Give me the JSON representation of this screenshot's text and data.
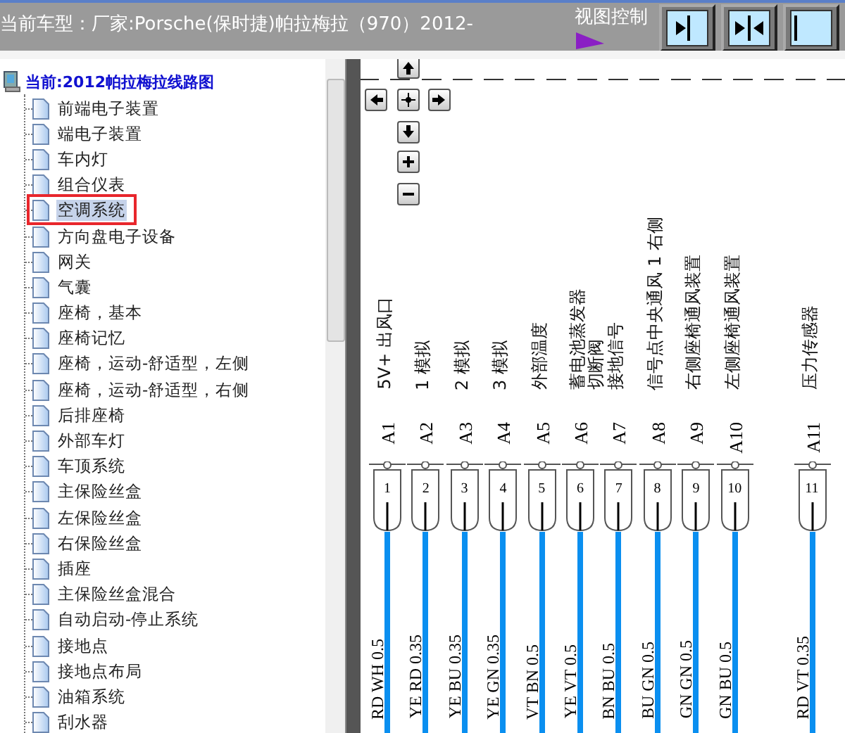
{
  "window": {
    "title": "当前车型：厂家:Porsche(保时捷)帕拉梅拉（970）2012-"
  },
  "view_control": {
    "label": "视图控制",
    "buttons": [
      {
        "kind": "collapse-right"
      },
      {
        "kind": "split"
      },
      {
        "kind": "partial"
      }
    ]
  },
  "tree": {
    "label": "当前:2012帕拉梅拉线路图",
    "expanded": true,
    "children": [
      {
        "label": "前端电子装置",
        "selected": false,
        "marked": false
      },
      {
        "label": "端电子装置",
        "selected": false,
        "marked": false
      },
      {
        "label": "车内灯",
        "selected": false,
        "marked": false
      },
      {
        "label": "组合仪表",
        "selected": false,
        "marked": false
      },
      {
        "label": "空调系统",
        "selected": true,
        "marked": true
      },
      {
        "label": "方向盘电子设备",
        "selected": false,
        "marked": false
      },
      {
        "label": "网关",
        "selected": false,
        "marked": false
      },
      {
        "label": "气囊",
        "selected": false,
        "marked": false
      },
      {
        "label": "座椅，基本",
        "selected": false,
        "marked": false
      },
      {
        "label": "座椅记忆",
        "selected": false,
        "marked": false
      },
      {
        "label": "座椅，运动-舒适型，左侧",
        "selected": false,
        "marked": false
      },
      {
        "label": "座椅，运动-舒适型，右侧",
        "selected": false,
        "marked": false
      },
      {
        "label": "后排座椅",
        "selected": false,
        "marked": false
      },
      {
        "label": "外部车灯",
        "selected": false,
        "marked": false
      },
      {
        "label": "车顶系统",
        "selected": false,
        "marked": false
      },
      {
        "label": "主保险丝盒",
        "selected": false,
        "marked": false
      },
      {
        "label": "左保险丝盒",
        "selected": false,
        "marked": false
      },
      {
        "label": "右保险丝盒",
        "selected": false,
        "marked": false
      },
      {
        "label": "插座",
        "selected": false,
        "marked": false
      },
      {
        "label": "主保险丝盒混合",
        "selected": false,
        "marked": false
      },
      {
        "label": "自动启动-停止系统",
        "selected": false,
        "marked": false
      },
      {
        "label": "接地点",
        "selected": false,
        "marked": false
      },
      {
        "label": "接地点布局",
        "selected": false,
        "marked": false
      },
      {
        "label": "油箱系统",
        "selected": false,
        "marked": false
      },
      {
        "label": "刮水器",
        "selected": false,
        "marked": false
      }
    ]
  },
  "diagram": {
    "pins": [
      {
        "signal": [
          "5V+ 出风口"
        ],
        "pin": "A1",
        "number": "1",
        "wire": "RD WH 0.5"
      },
      {
        "signal": [
          "1 模拟"
        ],
        "pin": "A2",
        "number": "2",
        "wire": "YE RD 0.35"
      },
      {
        "signal": [
          "2 模拟"
        ],
        "pin": "A3",
        "number": "3",
        "wire": "YE BU 0.35"
      },
      {
        "signal": [
          "3 模拟"
        ],
        "pin": "A4",
        "number": "4",
        "wire": "YE GN 0.35"
      },
      {
        "signal": [
          "外部温度"
        ],
        "pin": "A5",
        "number": "5",
        "wire": "VT BN 0.5"
      },
      {
        "signal": [
          "蓄电池蒸发器",
          "切断阀"
        ],
        "pin": "A6",
        "number": "6",
        "wire": "YE VT 0.5"
      },
      {
        "signal": [
          "接地信号"
        ],
        "pin": "A7",
        "number": "7",
        "wire": "BN BU 0.5"
      },
      {
        "signal": [
          "信号点中央通风 1 右侧"
        ],
        "pin": "A8",
        "number": "8",
        "wire": "BU GN 0.5"
      },
      {
        "signal": [
          "右侧座椅通风装置"
        ],
        "pin": "A9",
        "number": "9",
        "wire": "GN GN 0.5"
      },
      {
        "signal": [
          "左侧座椅通风装置"
        ],
        "pin": "A10",
        "number": "10",
        "wire": "GN BU 0.5"
      },
      {
        "signal": [
          "压力传感器"
        ],
        "pin": "A11",
        "number": "11",
        "wire": "RD VT 0.35"
      }
    ]
  }
}
